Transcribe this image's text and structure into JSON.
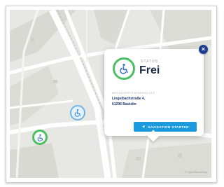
{
  "map": {
    "attribution": "© OpenStreetMap"
  },
  "popup": {
    "status_label": "STATUS",
    "status_value": "Frei",
    "address_label": "BEHINDERTENPARKPLATZ",
    "address_line1": "Lingelbachstraße 4,",
    "address_line2": "61296 Bautzlin",
    "navigation_button": "NAVIGATION STARTEN",
    "close_symbol": "×"
  },
  "colors": {
    "free": "#4cbf63",
    "primary": "#1b9ae0",
    "dark": "#1c2a46",
    "close": "#1d3f8f"
  },
  "icons": {
    "status": "wheelchair-icon",
    "navigation": "navigation-arrow-icon",
    "close": "close-icon"
  }
}
